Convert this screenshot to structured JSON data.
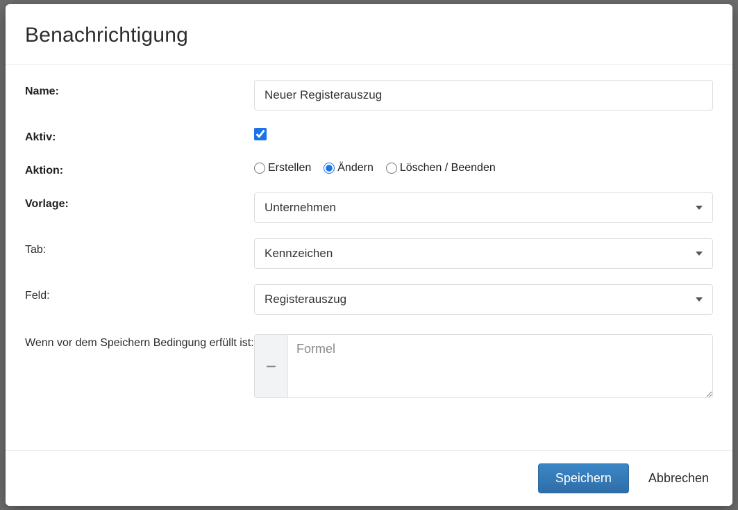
{
  "modal": {
    "title": "Benachrichtigung"
  },
  "form": {
    "name": {
      "label": "Name:",
      "value": "Neuer Registerauszug"
    },
    "active": {
      "label": "Aktiv:",
      "checked": true
    },
    "action": {
      "label": "Aktion:",
      "options": {
        "create": "Erstellen",
        "update": "Ändern",
        "delete": "Löschen / Beenden"
      },
      "selected": "update"
    },
    "template": {
      "label": "Vorlage:",
      "value": "Unternehmen"
    },
    "tab": {
      "label": "Tab:",
      "value": "Kennzeichen"
    },
    "field": {
      "label": "Feld:",
      "value": "Registerauszug"
    },
    "condition": {
      "label": "Wenn vor dem Speichern Bedingung erfüllt ist:",
      "placeholder": "Formel",
      "toggleGlyph": "−"
    }
  },
  "footer": {
    "save": "Speichern",
    "cancel": "Abbrechen"
  }
}
